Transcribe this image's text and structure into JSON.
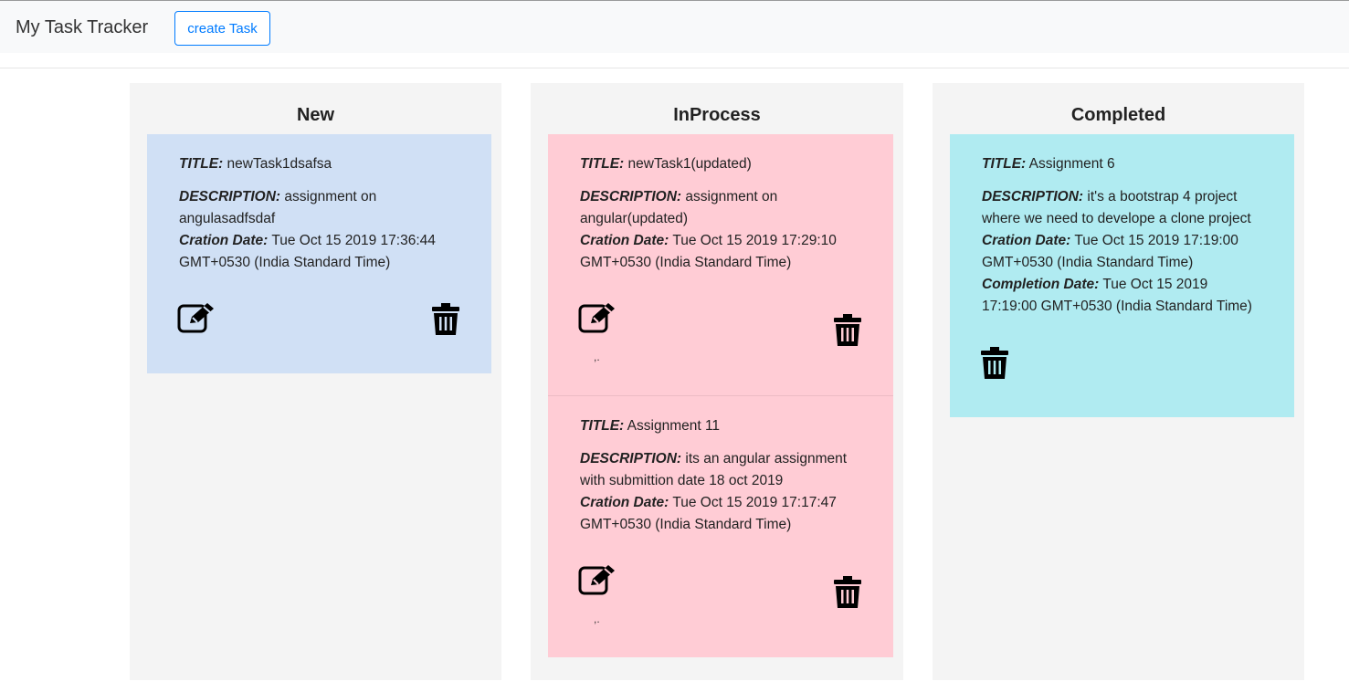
{
  "navbar": {
    "brand": "My Task Tracker",
    "create_button": "create Task"
  },
  "labels": {
    "title": "TITLE:",
    "description": "DESCRIPTION:",
    "creation_date": "Cration Date:",
    "completion_date": "Completion Date:"
  },
  "columns": [
    {
      "title": "New",
      "color": "#d0e0f5",
      "tasks": [
        {
          "title": "newTask1dsafsa",
          "description_1": "assignment on",
          "description_2": "angulasadfsdaf",
          "creation_date_1": "Tue Oct 15 2019 17:36:44",
          "creation_date_2": "GMT+0530 (India Standard Time)"
        }
      ]
    },
    {
      "title": "InProcess",
      "color": "#ffccd5",
      "tasks": [
        {
          "title": "newTask1(updated)",
          "description_1": "assignment on",
          "description_2": "angular(updated)",
          "creation_date_1": "Tue Oct 15 2019 17:29:10",
          "creation_date_2": "GMT+0530 (India Standard Time)",
          "mark": ",."
        },
        {
          "title": "Assignment 11",
          "description_1": "its an angular assignment",
          "description_2": "with submittion date 18 oct 2019",
          "creation_date_1": "Tue Oct 15 2019 17:17:47",
          "creation_date_2": "GMT+0530 (India Standard Time)",
          "mark": ",."
        }
      ]
    },
    {
      "title": "Completed",
      "color": "#b0ebf1",
      "tasks": [
        {
          "title": "Assignment 6",
          "description_1": "it's a bootstrap 4 project",
          "description_2": "where we need to develope a clone project",
          "creation_date_1": "Tue Oct 15 2019 17:19:00",
          "creation_date_2": "GMT+0530 (India Standard Time)",
          "completion_date_1": "Tue Oct 15 2019",
          "completion_date_2": "17:19:00 GMT+0530 (India Standard Time)"
        }
      ]
    }
  ],
  "icons": {
    "edit": "edit-icon",
    "delete": "trash-icon"
  }
}
